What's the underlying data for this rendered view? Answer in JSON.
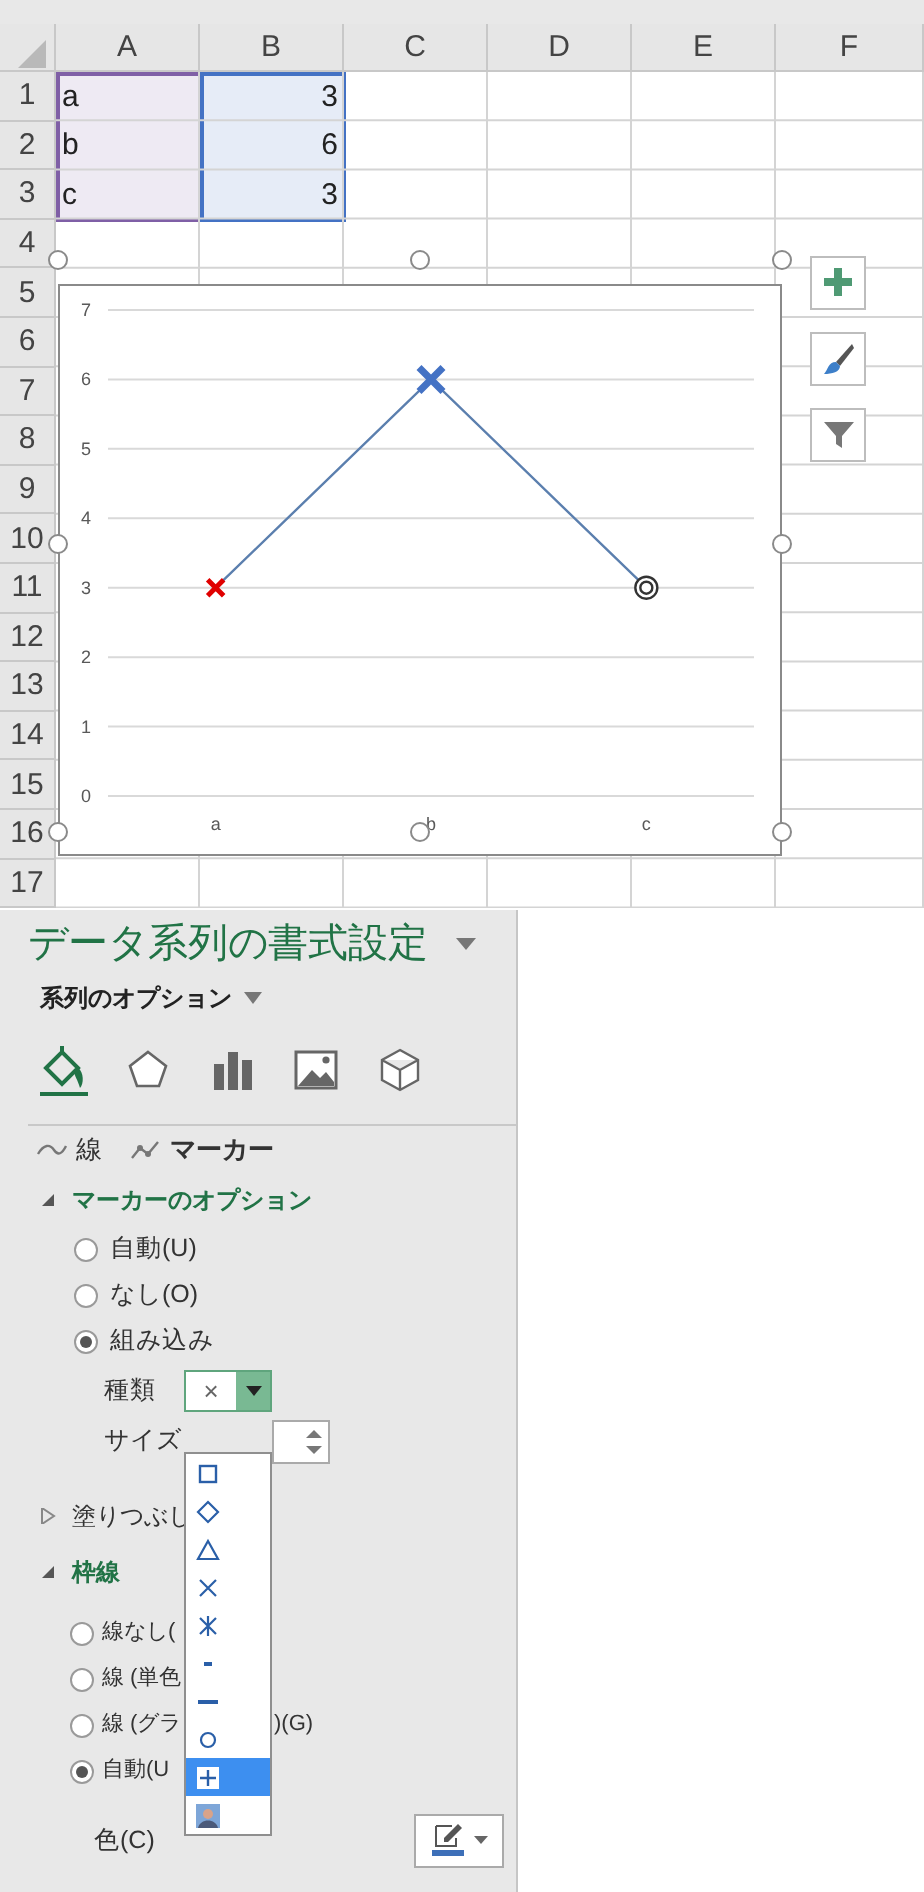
{
  "sheet": {
    "columns": [
      "A",
      "B",
      "C",
      "D",
      "E",
      "F"
    ],
    "rows": [
      {
        "header": "1",
        "cells": [
          "a",
          "3"
        ]
      },
      {
        "header": "2",
        "cells": [
          "b",
          "6"
        ]
      },
      {
        "header": "3",
        "cells": [
          "c",
          "3"
        ]
      },
      {
        "header": "4"
      },
      {
        "header": "5"
      },
      {
        "header": "6"
      },
      {
        "header": "7"
      },
      {
        "header": "8"
      },
      {
        "header": "9"
      },
      {
        "header": "10"
      },
      {
        "header": "11"
      },
      {
        "header": "12"
      },
      {
        "header": "13"
      },
      {
        "header": "14"
      },
      {
        "header": "15"
      },
      {
        "header": "16"
      },
      {
        "header": "17"
      }
    ],
    "reference_ranges": [
      {
        "color": "#7f5fa6"
      },
      {
        "color": "#4472c4"
      }
    ]
  },
  "chart": {
    "chart_data": {
      "type": "line",
      "categories": [
        "a",
        "b",
        "c"
      ],
      "series": [
        {
          "color": "#5b7fae",
          "values": [
            3,
            6,
            3
          ],
          "marker": true
        }
      ],
      "ylim": [
        0,
        7
      ],
      "yticks": [
        0,
        1,
        2,
        3,
        4,
        5,
        6,
        7
      ],
      "grid": true
    },
    "points": [
      {
        "kind": "cross",
        "color": "#e00000"
      },
      {
        "kind": "bold-cross",
        "color": "#4472c4"
      },
      {
        "kind": "double-circle",
        "color": "#333333"
      }
    ]
  },
  "pane": {
    "title": "データ系列の書式設定",
    "subtitle": "系列のオプション",
    "category_tabs": [
      {
        "kind": "fill",
        "selected": true
      },
      {
        "kind": "shape",
        "selected": false
      },
      {
        "kind": "bars",
        "selected": false
      },
      {
        "kind": "picture",
        "selected": false
      },
      {
        "kind": "cube",
        "selected": false
      }
    ],
    "tabs": [
      {
        "kind": "line",
        "label": "線",
        "selected": false
      },
      {
        "kind": "marker",
        "label": "マーカー",
        "selected": true
      }
    ],
    "marker_options": {
      "label": "マーカーのオプション",
      "expanded": true,
      "choices": [
        {
          "label": "自動(U)",
          "selected": false
        },
        {
          "label": "なし(O)",
          "selected": false
        },
        {
          "label": "組み込み",
          "selected": true
        }
      ],
      "type_label": "種類",
      "type_value": "×",
      "size_label": "サイズ"
    },
    "fill": {
      "label": "塗りつぶし",
      "expanded": false
    },
    "border": {
      "label": "枠線",
      "expanded": true,
      "choices": [
        {
          "label": "線なし(",
          "selected": false
        },
        {
          "label": "線 (単色",
          "selected": false
        },
        {
          "label": "線 (グラ",
          "label_end": ")(G)",
          "selected": false
        },
        {
          "label": "自動(U",
          "selected": true
        }
      ],
      "color_label": "色(C)"
    },
    "marker_type_list": [
      {
        "kind": "square",
        "selected": false
      },
      {
        "kind": "diamond",
        "selected": false
      },
      {
        "kind": "triangle",
        "selected": false
      },
      {
        "kind": "x",
        "selected": false
      },
      {
        "kind": "star",
        "selected": false
      },
      {
        "kind": "short-dash",
        "selected": false
      },
      {
        "kind": "long-dash",
        "selected": false
      },
      {
        "kind": "circle",
        "selected": false
      },
      {
        "kind": "plus",
        "selected": true
      },
      {
        "kind": "picture",
        "selected": false
      }
    ]
  }
}
